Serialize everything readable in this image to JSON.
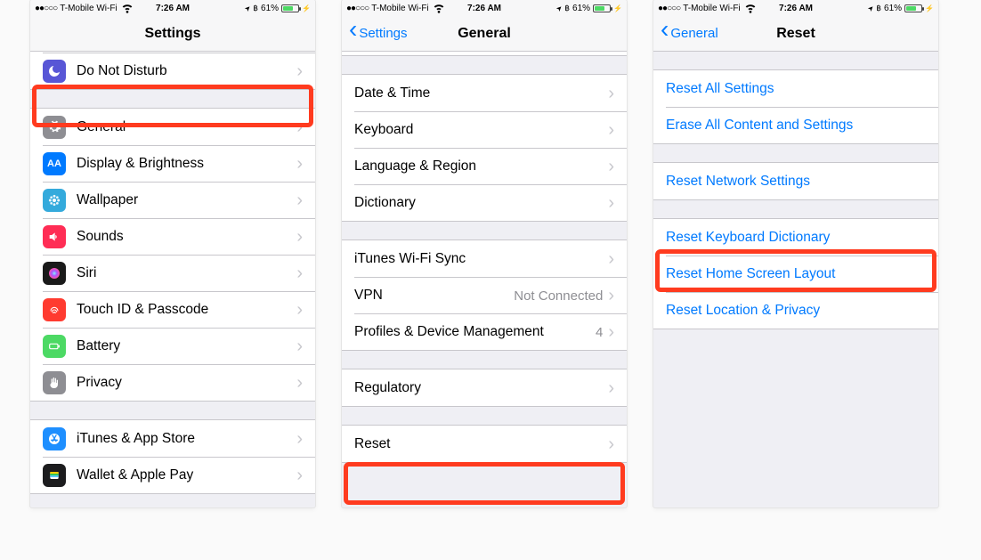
{
  "status": {
    "signal_dots": "●●○○○",
    "carrier": "T-Mobile Wi-Fi",
    "time": "7:26 AM",
    "battery_pct": "61%"
  },
  "phone1": {
    "nav_title": "Settings",
    "rows": {
      "dnd": "Do Not Disturb",
      "general": "General",
      "display": "Display & Brightness",
      "wallpaper": "Wallpaper",
      "sounds": "Sounds",
      "siri": "Siri",
      "touchid": "Touch ID & Passcode",
      "battery": "Battery",
      "privacy": "Privacy",
      "itunes": "iTunes & App Store",
      "walletpay": "Wallet & Apple Pay"
    }
  },
  "phone2": {
    "nav_back": "Settings",
    "nav_title": "General",
    "rows": {
      "datetime": "Date & Time",
      "keyboard": "Keyboard",
      "langregion": "Language & Region",
      "dictionary": "Dictionary",
      "ituneswifi": "iTunes Wi-Fi Sync",
      "vpn": "VPN",
      "vpn_detail": "Not Connected",
      "profiles": "Profiles & Device Management",
      "profiles_detail": "4",
      "regulatory": "Regulatory",
      "reset": "Reset"
    }
  },
  "phone3": {
    "nav_back": "General",
    "nav_title": "Reset",
    "rows": {
      "reset_all": "Reset All Settings",
      "erase_all": "Erase All Content and Settings",
      "reset_network": "Reset Network Settings",
      "reset_kbd": "Reset Keyboard Dictionary",
      "reset_home": "Reset Home Screen Layout",
      "reset_loc": "Reset Location & Privacy"
    }
  }
}
